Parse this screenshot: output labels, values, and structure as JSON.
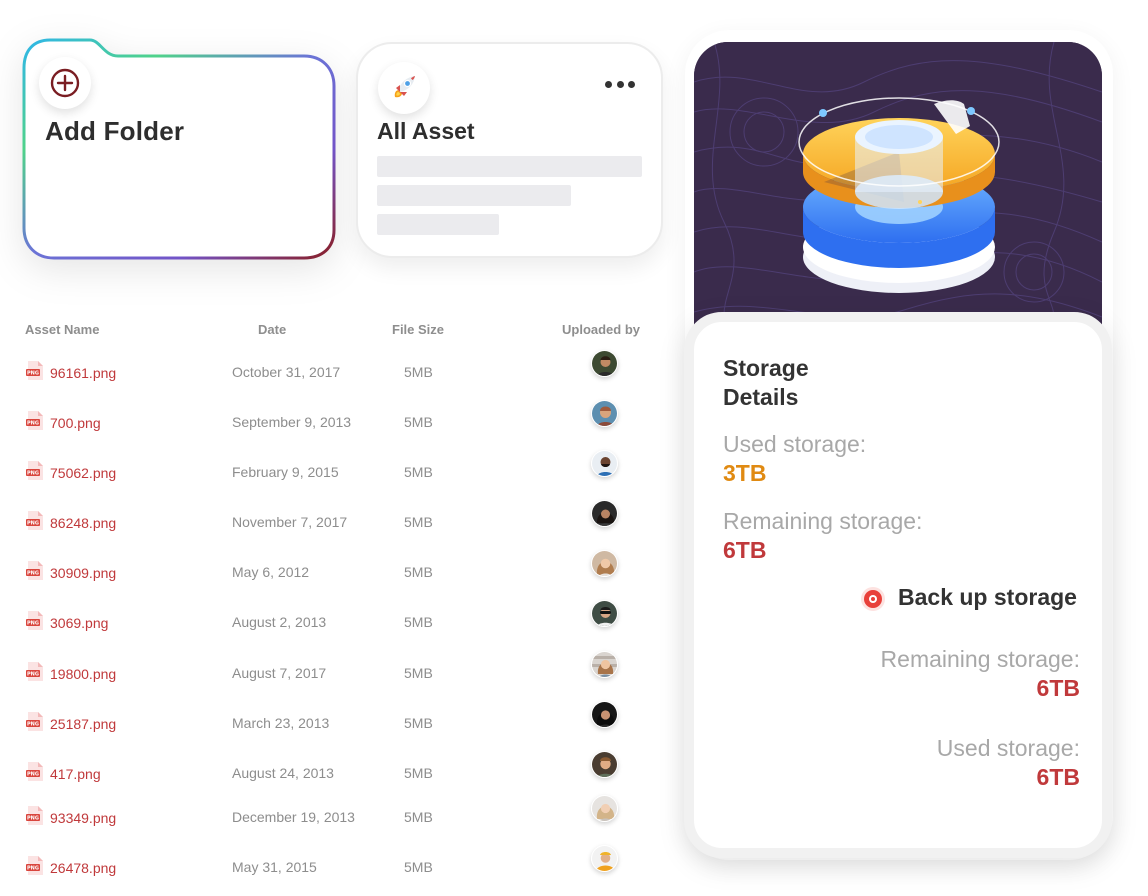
{
  "add_folder": {
    "title": "Add Folder",
    "icon": "plus-circle-icon",
    "accent": "#7a1d22"
  },
  "all_asset": {
    "title": "All Asset",
    "icon": "rocket-icon",
    "more_icon": "more-horizontal-icon"
  },
  "table": {
    "headers": {
      "name": "Asset Name",
      "date": "Date",
      "size": "File Size",
      "uploader": "Uploaded by"
    },
    "rows": [
      {
        "name": "96161.png",
        "date": "October 31, 2017",
        "size": "5MB"
      },
      {
        "name": "700.png",
        "date": "September 9, 2013",
        "size": "5MB"
      },
      {
        "name": "75062.png",
        "date": "February 9, 2015",
        "size": "5MB"
      },
      {
        "name": "86248.png",
        "date": "November 7, 2017",
        "size": "5MB"
      },
      {
        "name": "30909.png",
        "date": "May 6, 2012",
        "size": "5MB"
      },
      {
        "name": "3069.png",
        "date": "August 2, 2013",
        "size": "5MB"
      },
      {
        "name": "19800.png",
        "date": "August 7, 2017",
        "size": "5MB"
      },
      {
        "name": "25187.png",
        "date": "March 23, 2013",
        "size": "5MB"
      },
      {
        "name": "417.png",
        "date": "August 24, 2013",
        "size": "5MB"
      },
      {
        "name": "93349.png",
        "date": "December 19, 2013",
        "size": "5MB"
      },
      {
        "name": "26478.png",
        "date": "May 31, 2015",
        "size": "5MB"
      }
    ],
    "file_icon": "png-file-icon",
    "file_icon_label": "PNG"
  },
  "storage": {
    "title": "Storage Details",
    "used_label": "Used storage:",
    "used_value": "3TB",
    "remaining_label": "Remaining storage:",
    "remaining_value": "6TB",
    "backup_label": "Back up storage",
    "backup_remaining_label": "Remaining storage:",
    "backup_remaining_value": "6TB",
    "backup_used_label": "Used storage:",
    "backup_used_value": "6TB",
    "colors": {
      "used": "#e08a12",
      "remaining": "#c0393b",
      "backup_dot": "#e8403a"
    }
  }
}
